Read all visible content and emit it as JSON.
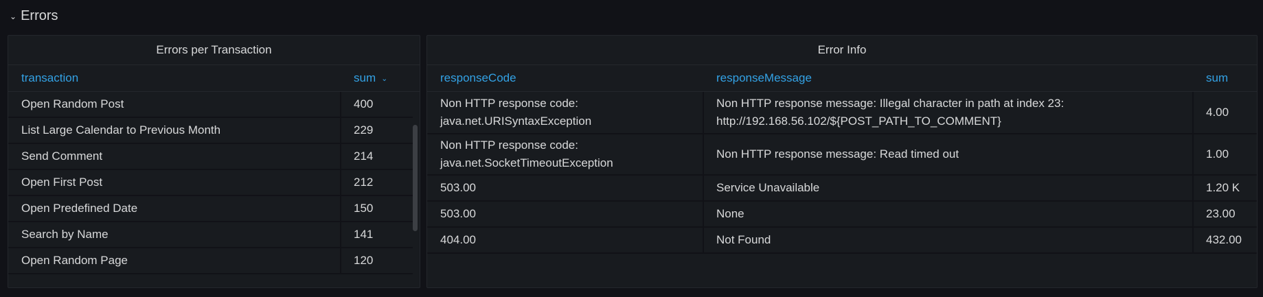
{
  "row": {
    "title": "Errors"
  },
  "left_panel": {
    "title": "Errors per Transaction",
    "columns": [
      "transaction",
      "sum"
    ],
    "rows": [
      [
        "Open Random Post",
        "400"
      ],
      [
        "List Large Calendar to Previous Month",
        "229"
      ],
      [
        "Send Comment",
        "214"
      ],
      [
        "Open First Post",
        "212"
      ],
      [
        "Open Predefined Date",
        "150"
      ],
      [
        "Search by Name",
        "141"
      ],
      [
        "Open Random Page",
        "120"
      ]
    ]
  },
  "right_panel": {
    "title": "Error Info",
    "columns": [
      "responseCode",
      "responseMessage",
      "sum"
    ],
    "rows": [
      [
        "Non HTTP response code: java.net.URISyntaxException",
        "Non HTTP response message: Illegal character in path at index 23: http://192.168.56.102/${POST_PATH_TO_COMMENT}",
        "4.00"
      ],
      [
        "Non HTTP response code: java.net.SocketTimeoutException",
        "Non HTTP response message: Read timed out",
        "1.00"
      ],
      [
        "503.00",
        "Service Unavailable",
        "1.20 K"
      ],
      [
        "503.00",
        "None",
        "23.00"
      ],
      [
        "404.00",
        "Not Found",
        "432.00"
      ]
    ]
  },
  "colors": {
    "background": "#111217",
    "panel": "#181b1f",
    "accent": "#33a2e5",
    "text": "#d8d9da"
  }
}
